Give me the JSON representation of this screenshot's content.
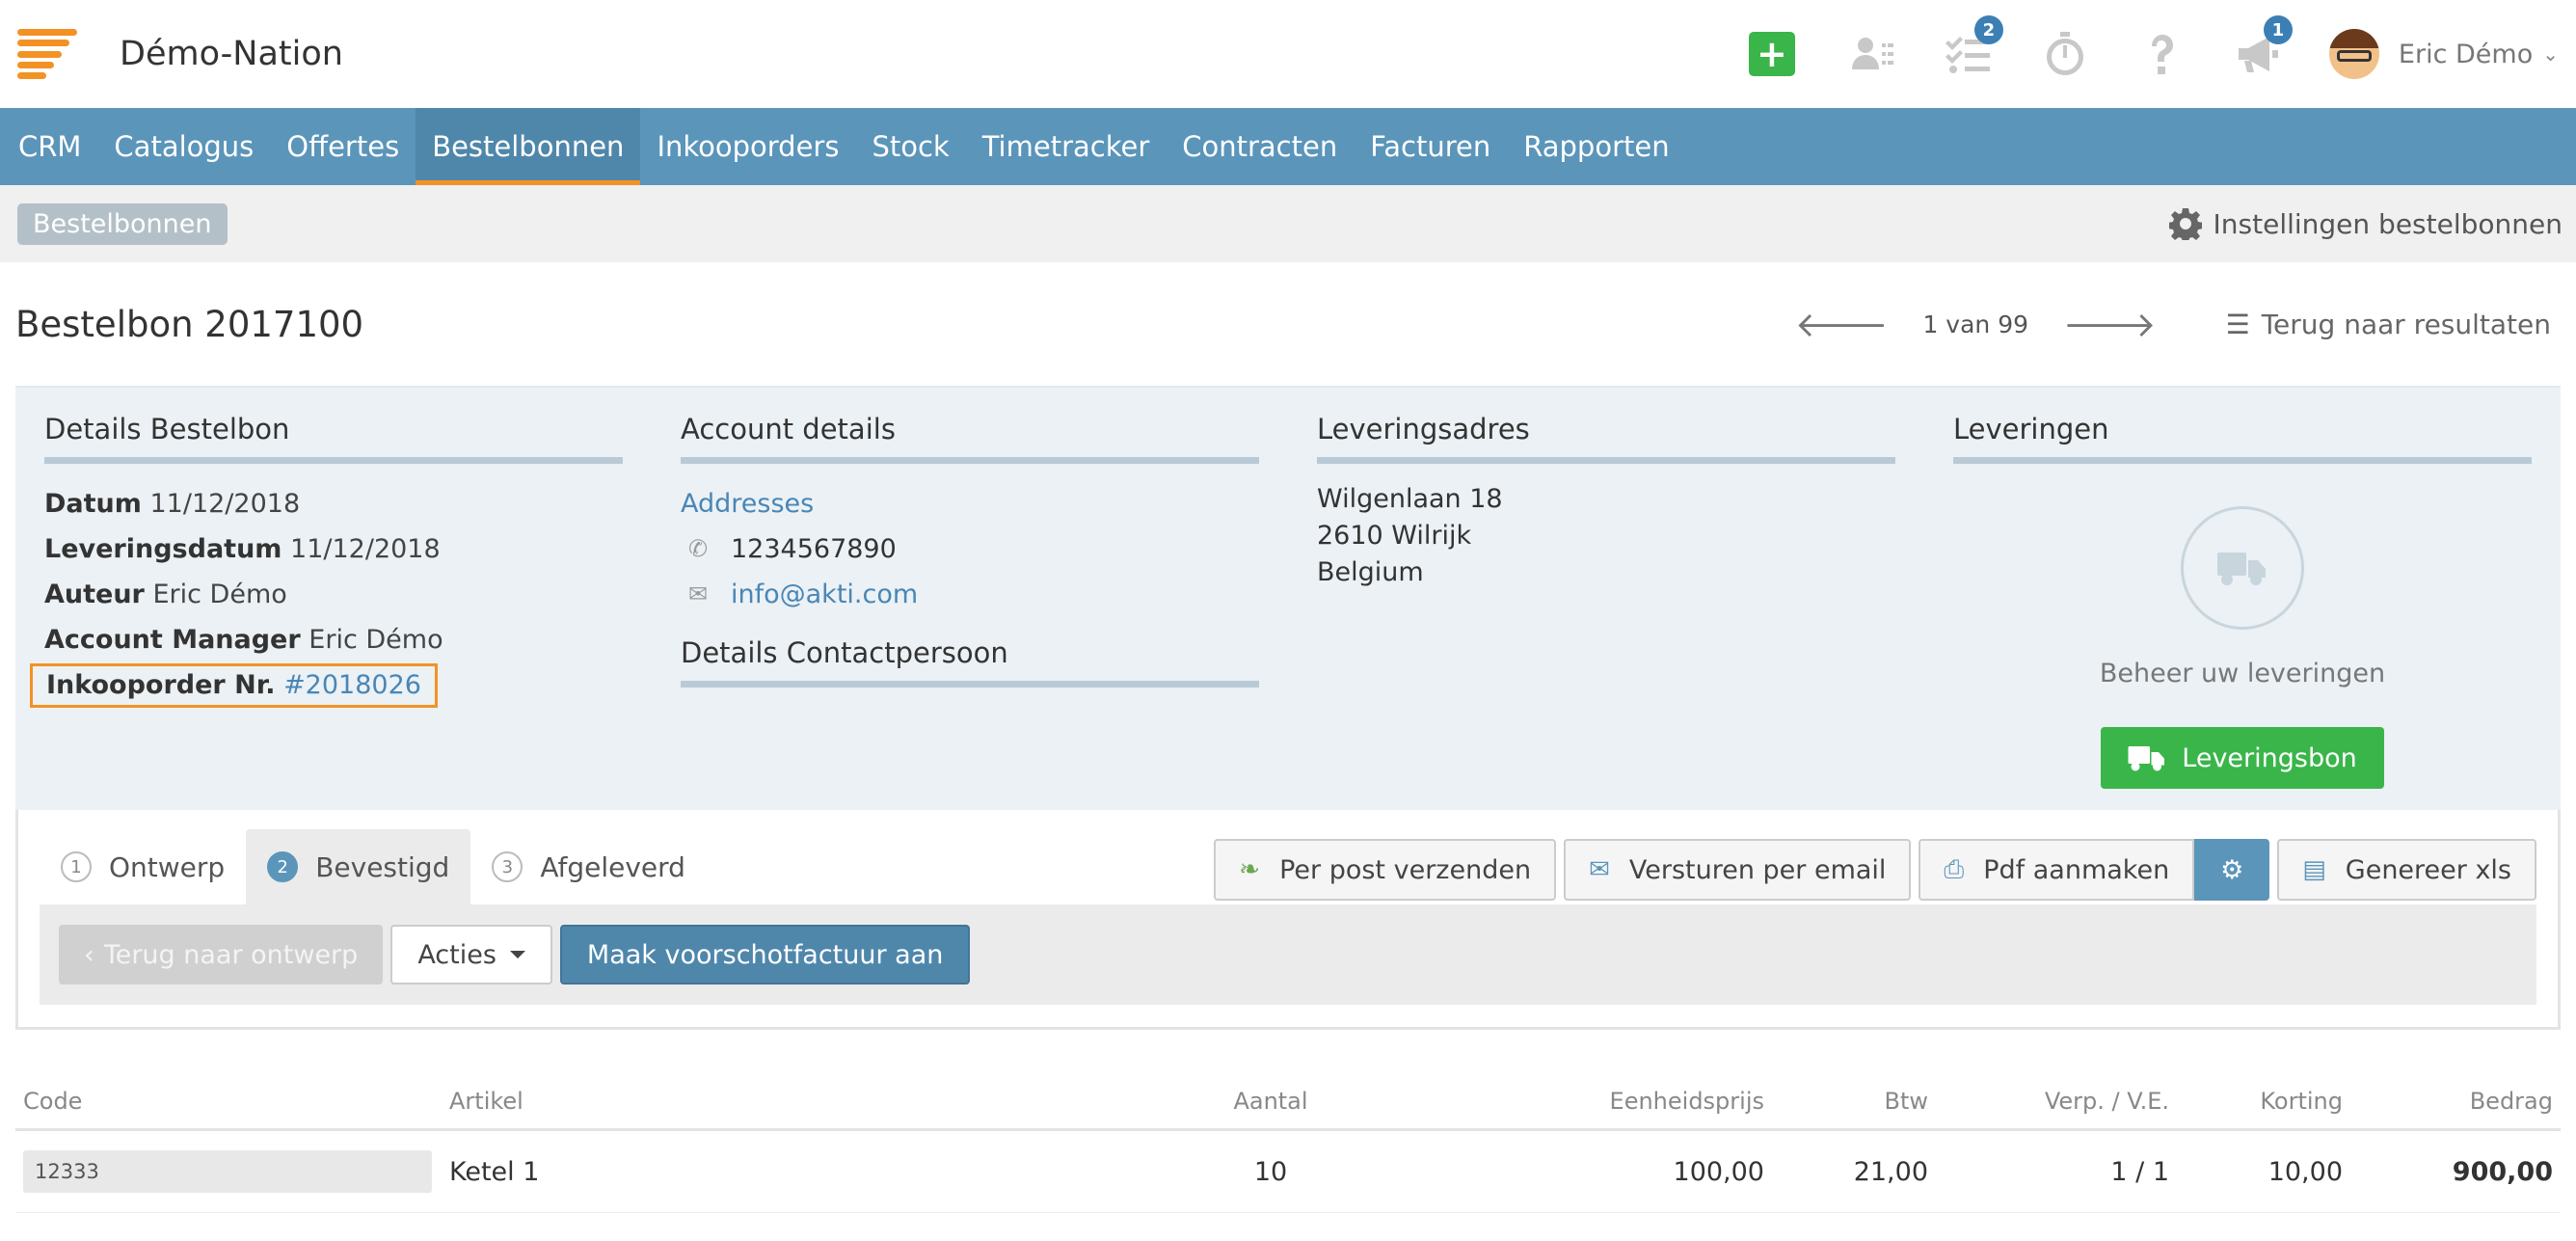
{
  "app": {
    "title": "Démo-Nation"
  },
  "topbar": {
    "badges": {
      "tasks": "2",
      "announcements": "1"
    },
    "user_name": "Eric Démo",
    "plus_label": "+"
  },
  "nav": {
    "items": [
      {
        "label": "CRM"
      },
      {
        "label": "Catalogus"
      },
      {
        "label": "Offertes"
      },
      {
        "label": "Bestelbonnen",
        "active": true
      },
      {
        "label": "Inkooporders"
      },
      {
        "label": "Stock"
      },
      {
        "label": "Timetracker"
      },
      {
        "label": "Contracten"
      },
      {
        "label": "Facturen"
      },
      {
        "label": "Rapporten"
      }
    ]
  },
  "breadcrumb": {
    "label": "Bestelbonnen"
  },
  "settings_link": {
    "label": "Instellingen bestelbonnen"
  },
  "page": {
    "title": "Bestelbon 2017100",
    "pager": "1 van 99",
    "back_results": "Terug naar resultaten"
  },
  "details": {
    "heading": "Details Bestelbon",
    "datum": {
      "label": "Datum",
      "value": "11/12/2018"
    },
    "leveringsdatum": {
      "label": "Leveringsdatum",
      "value": "11/12/2018"
    },
    "auteur": {
      "label": "Auteur",
      "value": "Eric Démo"
    },
    "account_manager": {
      "label": "Account Manager",
      "value": "Eric Démo"
    },
    "inkooporder": {
      "label": "Inkooporder Nr.",
      "value": "#2018026"
    }
  },
  "account": {
    "heading": "Account details",
    "addresses_link": "Addresses",
    "phone": "1234567890",
    "email": "info@akti.com",
    "contact_heading": "Details Contactpersoon"
  },
  "delivery_address": {
    "heading": "Leveringsadres",
    "line1": "Wilgenlaan 18",
    "line2": "2610 Wilrijk",
    "line3": "Belgium"
  },
  "deliveries": {
    "heading": "Leveringen",
    "manage_text": "Beheer uw leveringen",
    "button_label": "Leveringsbon"
  },
  "steps": [
    {
      "num": "1",
      "label": "Ontwerp"
    },
    {
      "num": "2",
      "label": "Bevestigd",
      "active": true
    },
    {
      "num": "3",
      "label": "Afgeleverd"
    }
  ],
  "doc_buttons": {
    "post": "Per post verzenden",
    "email": "Versturen per email",
    "pdf": "Pdf aanmaken",
    "xls": "Genereer xls"
  },
  "actions": {
    "back_to_draft": "Terug naar ontwerp",
    "acties": "Acties",
    "advance_invoice": "Maak voorschotfactuur aan"
  },
  "table": {
    "headers": [
      "Code",
      "Artikel",
      "Aantal",
      "Eenheidsprijs",
      "Btw",
      "Verp. / V.E.",
      "Korting",
      "Bedrag"
    ],
    "rows": [
      {
        "code": "12333",
        "artikel": "Ketel 1",
        "aantal": "10",
        "eenheidsprijs": "100,00",
        "btw": "21,00",
        "verp": "1 / 1",
        "korting": "10,00",
        "bedrag": "900,00"
      }
    ]
  },
  "colors": {
    "accent_orange": "#f39224",
    "nav_blue": "#5b95ba",
    "green": "#3ab54a",
    "link_blue": "#4a86b5"
  }
}
